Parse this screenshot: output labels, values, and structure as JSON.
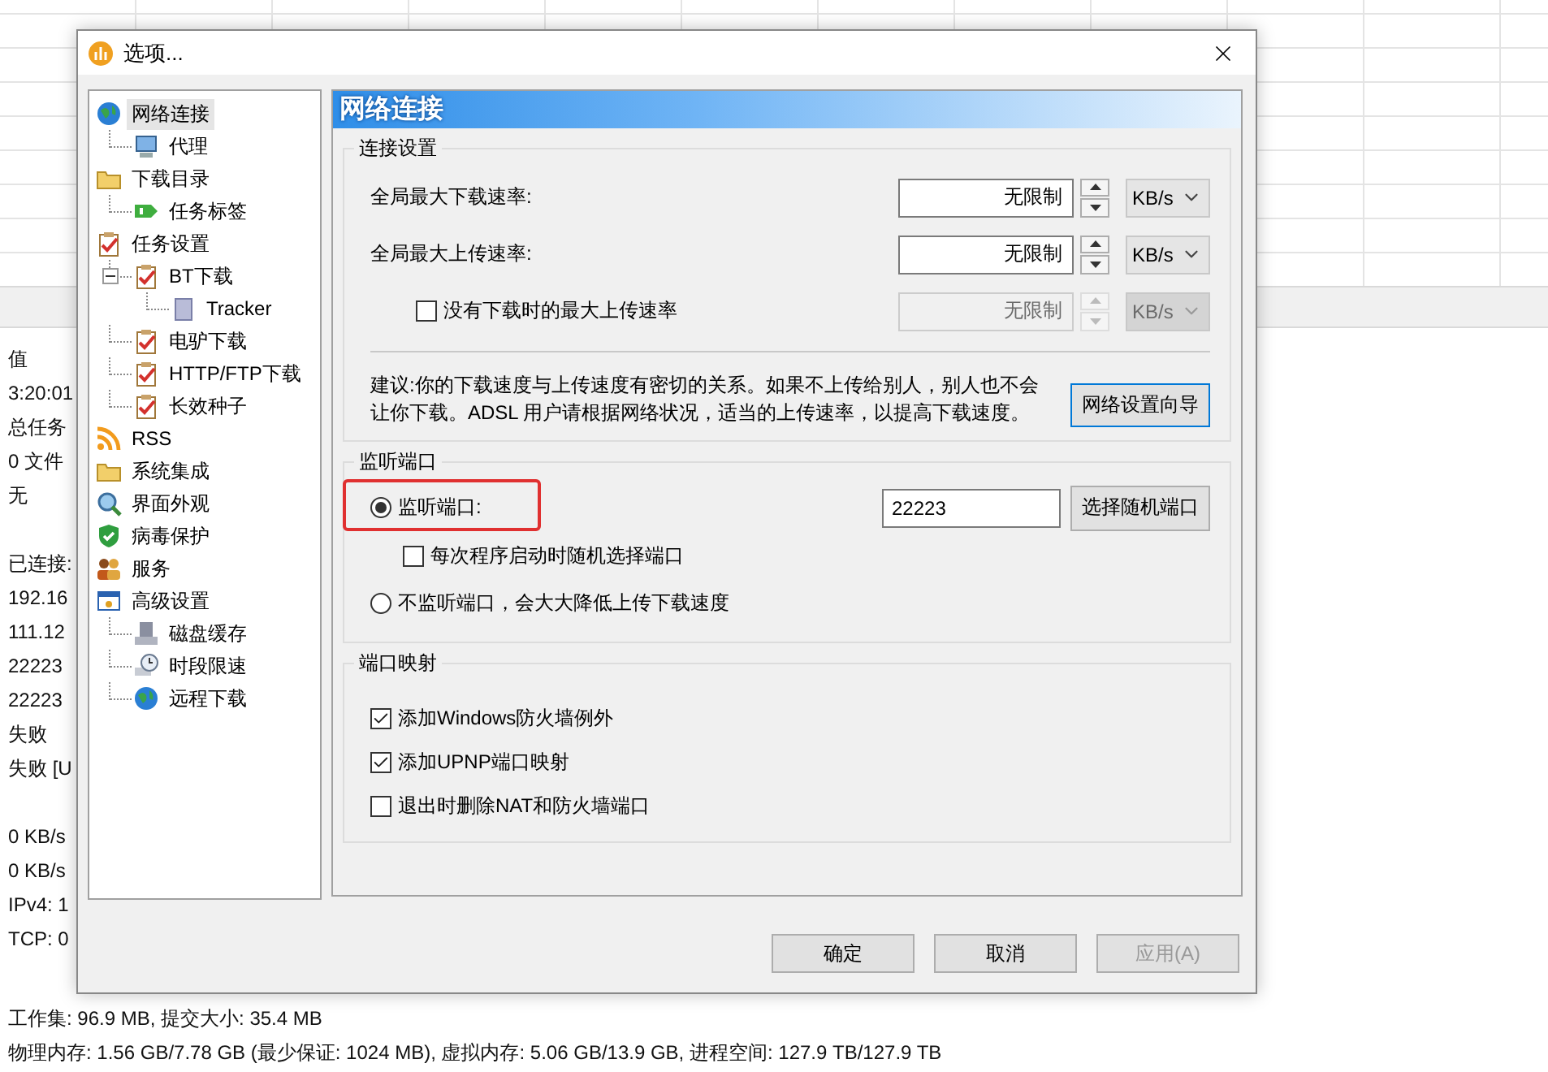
{
  "background": {
    "rows": [
      "值",
      "3:20:01",
      "总任务",
      "0 文件",
      "无",
      "",
      "已连接:",
      "192.16",
      "111.12",
      "22223",
      "22223",
      "失败",
      "失败 [U",
      "",
      "0 KB/s",
      "0 KB/s",
      "IPv4: 1",
      "TCP: 0"
    ],
    "status_lines": [
      "工作集: 96.9 MB, 提交大小: 35.4 MB",
      "物理内存: 1.56 GB/7.78 GB (最少保证: 1024 MB), 虚拟内存: 5.06 GB/13.9 GB, 进程空间: 127.9 TB/127.9 TB"
    ]
  },
  "window": {
    "title": "选项..."
  },
  "tree": [
    {
      "label": "网络连接",
      "selected": true,
      "children": [
        {
          "label": "代理",
          "selected": false
        }
      ]
    },
    {
      "label": "下载目录",
      "selected": false,
      "children": [
        {
          "label": "任务标签",
          "selected": false
        }
      ]
    },
    {
      "label": "任务设置",
      "selected": false,
      "children": [
        {
          "label": "BT下载",
          "selected": false,
          "expanded": true,
          "children": [
            {
              "label": "Tracker",
              "selected": false
            }
          ]
        },
        {
          "label": "电驴下载",
          "selected": false
        },
        {
          "label": "HTTP/FTP下载",
          "selected": false
        },
        {
          "label": "长效种子",
          "selected": false
        }
      ]
    },
    {
      "label": "RSS",
      "selected": false
    },
    {
      "label": "系统集成",
      "selected": false
    },
    {
      "label": "界面外观",
      "selected": false
    },
    {
      "label": "病毒保护",
      "selected": false
    },
    {
      "label": "服务",
      "selected": false
    },
    {
      "label": "高级设置",
      "selected": false,
      "children": [
        {
          "label": "磁盘缓存",
          "selected": false
        },
        {
          "label": "时段限速",
          "selected": false
        },
        {
          "label": "远程下载",
          "selected": false
        }
      ]
    }
  ],
  "panel": {
    "title": "网络连接",
    "connection": {
      "title": "连接设置",
      "rates": [
        {
          "kind": "plain",
          "label": "全局最大下载速率:",
          "value": "无限制",
          "unit": "KB/s",
          "disabled": false
        },
        {
          "kind": "plain",
          "label": "全局最大上传速率:",
          "value": "无限制",
          "unit": "KB/s",
          "disabled": false
        },
        {
          "kind": "checkbox",
          "label": "没有下载时的最大上传速率",
          "checked": false,
          "value": "无限制",
          "unit": "KB/s",
          "disabled": true
        }
      ],
      "advice": "建议:你的下载速度与上传速度有密切的关系。如果不上传给别人，别人也不会让你下载。ADSL 用户请根据网络状况，适当的上传速率，以提高下载速度。",
      "wizard_button": "网络设置向导"
    },
    "listen": {
      "title": "监听端口",
      "options": [
        {
          "kind": "radio",
          "label": "监听端口:",
          "selected": true,
          "highlighted": true,
          "port": "22223",
          "button": "选择随机端口"
        },
        {
          "kind": "checkbox",
          "label": "每次程序启动时随机选择端口",
          "checked": false
        },
        {
          "kind": "radio",
          "label": "不监听端口，会大大降低上传下载速度",
          "selected": false,
          "highlighted": false
        }
      ]
    },
    "mapping": {
      "title": "端口映射",
      "options": [
        {
          "label": "添加Windows防火墙例外",
          "checked": true
        },
        {
          "label": "添加UPNP端口映射",
          "checked": true
        },
        {
          "label": "退出时删除NAT和防火墙端口",
          "checked": false
        }
      ]
    }
  },
  "buttons": [
    {
      "label": "确定",
      "disabled": false
    },
    {
      "label": "取消",
      "disabled": false
    },
    {
      "label": "应用(A)",
      "disabled": true
    }
  ]
}
